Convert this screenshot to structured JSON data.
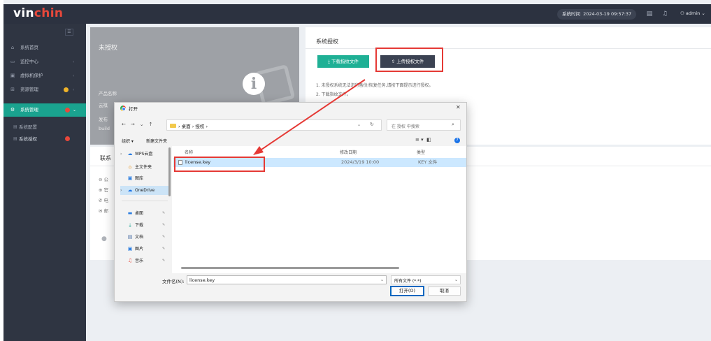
{
  "app": {
    "logo_main": "vin",
    "logo_accent": "chin",
    "time_label": "系统时间",
    "time_value": "2024-03-19 09:57:37",
    "user": "admin",
    "accent_color": "#1aa38f"
  },
  "sidebar": {
    "items": [
      {
        "label": "系统首页",
        "icon": "home-icon"
      },
      {
        "label": "监控中心",
        "icon": "monitor-icon"
      },
      {
        "label": "虚拟机保护",
        "icon": "vm-icon"
      },
      {
        "label": "资源管理",
        "icon": "grid-icon"
      },
      {
        "label": "系统管理",
        "icon": "gear-icon"
      }
    ],
    "sub_items": [
      {
        "label": "系统配置"
      },
      {
        "label": "系统授权"
      }
    ]
  },
  "license_card": {
    "status": "未授权",
    "product_label": "产品名称",
    "product_value": "云祺",
    "release_label": "发布",
    "build_label": "build"
  },
  "auth_card": {
    "title": "系统授权",
    "download_btn": "下载指纹文件",
    "upload_btn": "上传授权文件",
    "note1": "1. 未授权系统无法进行备份/恢复任务,请按下面提示进行授权。",
    "note2": "2. 下载指纹文件。"
  },
  "contact_card": {
    "title": "联系",
    "rows": [
      "公",
      "官",
      "电",
      "邮"
    ]
  },
  "dialog": {
    "title": "打开",
    "path": [
      "桌面",
      "授权"
    ],
    "search_placeholder": "在 授权 中搜索",
    "organize": "组织 ▾",
    "new_folder": "新建文件夹",
    "nav": [
      {
        "label": "WPS云盘",
        "icon": "cloud-icon",
        "chev": "›"
      },
      {
        "label": "主文件夹",
        "icon": "home-icon",
        "chev": ""
      },
      {
        "label": "图库",
        "icon": "gallery-icon",
        "chev": ""
      },
      {
        "label": "OneDrive",
        "icon": "onedrive-icon",
        "chev": "›"
      },
      {
        "label": "桌面",
        "icon": "desktop-icon",
        "chev": ""
      },
      {
        "label": "下载",
        "icon": "download-icon",
        "chev": ""
      },
      {
        "label": "文档",
        "icon": "document-icon",
        "chev": ""
      },
      {
        "label": "图片",
        "icon": "picture-icon",
        "chev": ""
      },
      {
        "label": "音乐",
        "icon": "music-icon",
        "chev": ""
      }
    ],
    "columns": {
      "name": "名称",
      "modified": "修改日期",
      "type": "类型"
    },
    "files": [
      {
        "name": "license.key",
        "modified": "2024/3/19 10:00",
        "type": "KEY 文件"
      }
    ],
    "filename_label": "文件名(N):",
    "filename_value": "license.key",
    "filetype": "所有文件 (*.*)",
    "open_btn": "打开(O)",
    "cancel_btn": "取消"
  }
}
